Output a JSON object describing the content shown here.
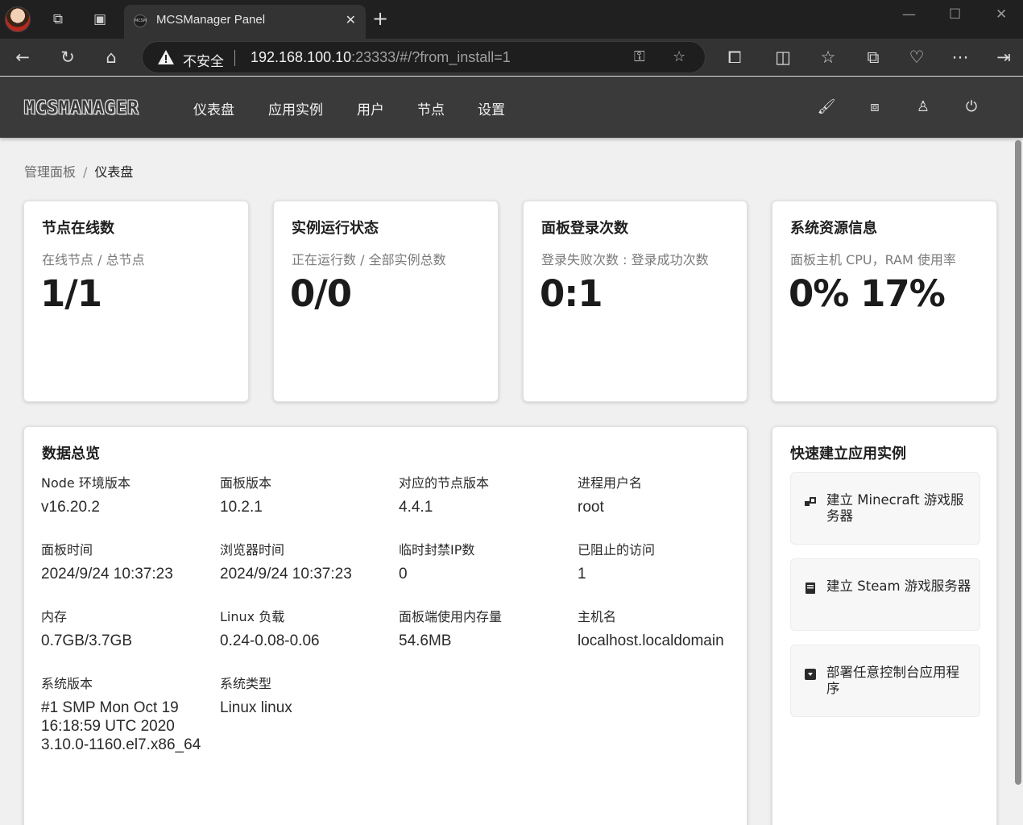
{
  "browser": {
    "tab_title": "MCSManager Panel",
    "favicon_text": "MCSM",
    "security_label": "不安全",
    "url_host": "192.168.100.10",
    "url_rest": ":23333/#/?from_install=1"
  },
  "app": {
    "logo": "MCSMANAGER",
    "nav": {
      "dashboard": "仪表盘",
      "instances": "应用实例",
      "users": "用户",
      "nodes": "节点",
      "settings": "设置"
    }
  },
  "breadcrumb": {
    "root": "管理面板",
    "separator": "/",
    "current": "仪表盘"
  },
  "stats": [
    {
      "title": "节点在线数",
      "subtitle": "在线节点 / 总节点",
      "value": "1/1"
    },
    {
      "title": "实例运行状态",
      "subtitle": "正在运行数 / 全部实例总数",
      "value": "0/0"
    },
    {
      "title": "面板登录次数",
      "subtitle": "登录失败次数 : 登录成功次数",
      "value": "0:1"
    },
    {
      "title": "系统资源信息",
      "subtitle": "面板主机 CPU，RAM 使用率",
      "value": "0% 17%"
    }
  ],
  "overview": {
    "title": "数据总览",
    "items": [
      {
        "label": "Node 环境版本",
        "value": "v16.20.2"
      },
      {
        "label": "面板版本",
        "value": "10.2.1"
      },
      {
        "label": "对应的节点版本",
        "value": "4.4.1"
      },
      {
        "label": "进程用户名",
        "value": "root"
      },
      {
        "label": "面板时间",
        "value": "2024/9/24 10:37:23"
      },
      {
        "label": "浏览器时间",
        "value": "2024/9/24 10:37:23"
      },
      {
        "label": "临时封禁IP数",
        "value": "0"
      },
      {
        "label": "已阻止的访问",
        "value": "1"
      },
      {
        "label": "内存",
        "value": "0.7GB/3.7GB"
      },
      {
        "label": "Linux 负载",
        "value": "0.24-0.08-0.06"
      },
      {
        "label": "面板端使用内存量",
        "value": "54.6MB"
      },
      {
        "label": "主机名",
        "value": "localhost.localdomain"
      },
      {
        "label": "系统版本",
        "value": "#1 SMP Mon Oct 19 16:18:59 UTC 2020 3.10.0-1160.el7.x86_64"
      },
      {
        "label": "系统类型",
        "value": "Linux linux"
      }
    ]
  },
  "quick_create": {
    "title": "快速建立应用实例",
    "buttons": [
      {
        "label": "建立 Minecraft 游戏服务器",
        "icon": "minecraft-blocks-icon"
      },
      {
        "label": "建立 Steam 游戏服务器",
        "icon": "server-icon"
      },
      {
        "label": "部署任意控制台应用程序",
        "icon": "deploy-box-icon"
      }
    ]
  }
}
